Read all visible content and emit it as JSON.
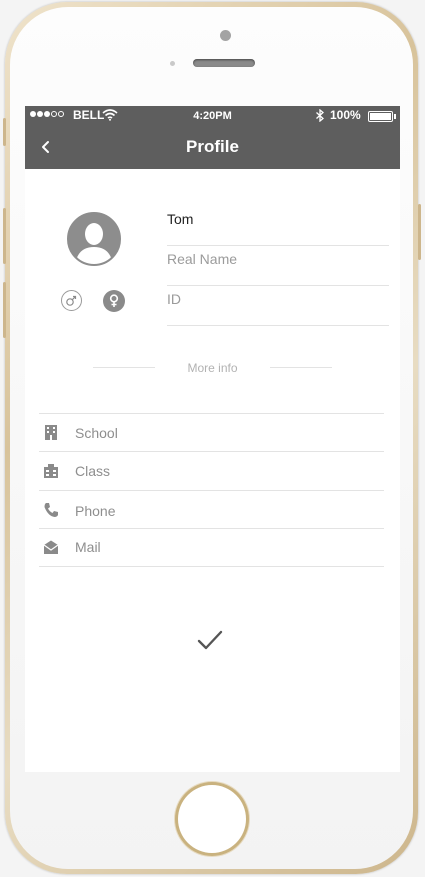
{
  "status_bar": {
    "carrier": "BELL",
    "time": "4:20PM",
    "battery": "100%",
    "signal_bars": 3,
    "signal_total": 5
  },
  "nav": {
    "title": "Profile",
    "back_icon": "chevron-left-icon"
  },
  "profile": {
    "avatar_icon": "user-avatar-icon",
    "name_value": "Tom",
    "real_name_placeholder": "Real Name",
    "id_placeholder": "ID",
    "gender_options": [
      "male-icon",
      "female-icon"
    ],
    "gender_selected": "female"
  },
  "more_info_label": "More info",
  "info_rows": [
    {
      "label": "School",
      "icon": "building-icon"
    },
    {
      "label": "Class",
      "icon": "classroom-icon"
    },
    {
      "label": "Phone",
      "icon": "phone-icon"
    },
    {
      "label": "Mail",
      "icon": "mail-icon"
    }
  ],
  "confirm_icon": "checkmark-icon",
  "colors": {
    "bar": "#5e5e5e",
    "frame": "#d8c39b",
    "placeholder": "#9b9b9b",
    "divider": "#e3e3e3"
  }
}
